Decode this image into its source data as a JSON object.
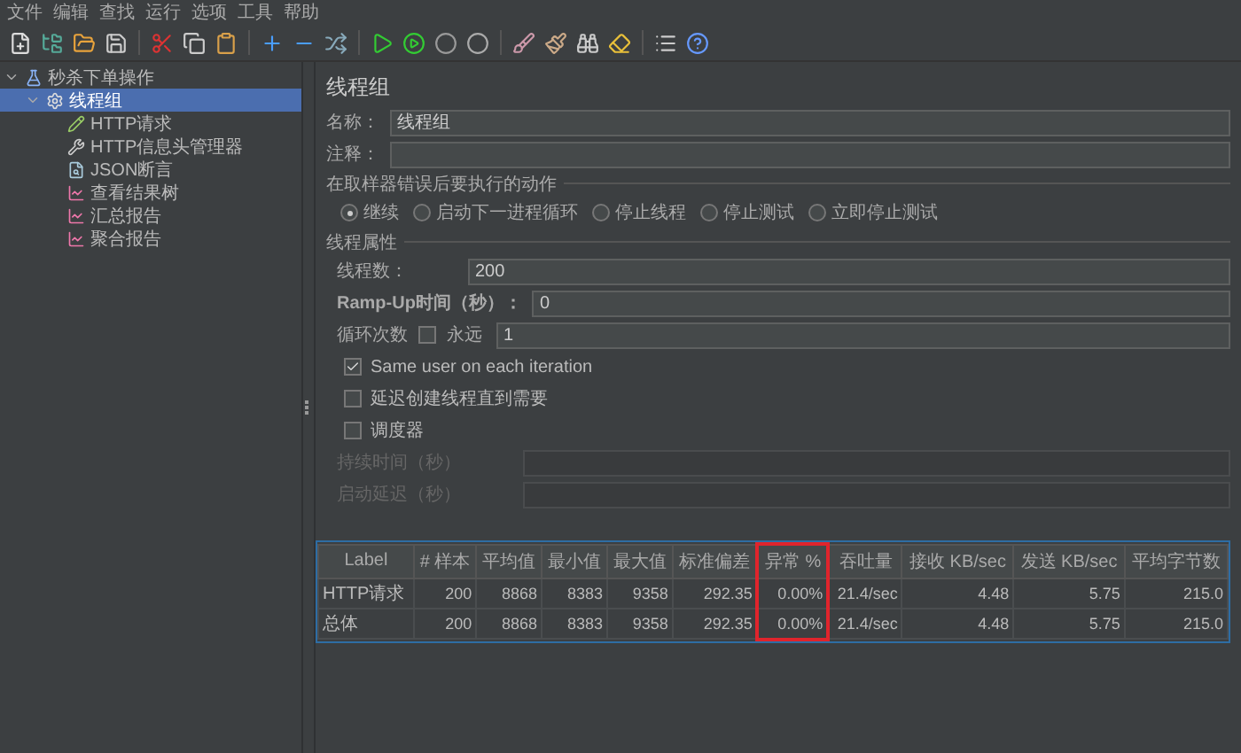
{
  "menu": [
    "文件",
    "编辑",
    "查找",
    "运行",
    "选项",
    "工具",
    "帮助"
  ],
  "tree": [
    {
      "label": "秒杀下单操作",
      "kind": "plan",
      "expanded": true,
      "selected": false,
      "children": [
        {
          "label": "线程组",
          "kind": "threads",
          "expanded": true,
          "selected": true,
          "children": [
            {
              "label": "HTTP请求",
              "kind": "sampler",
              "selected": false
            },
            {
              "label": "HTTP信息头管理器",
              "kind": "config",
              "selected": false
            },
            {
              "label": "JSON断言",
              "kind": "assertion",
              "selected": false
            },
            {
              "label": "查看结果树",
              "kind": "listener",
              "selected": false
            },
            {
              "label": "汇总报告",
              "kind": "listener",
              "selected": false
            },
            {
              "label": "聚合报告",
              "kind": "listener",
              "selected": false
            }
          ]
        }
      ]
    }
  ],
  "panel": {
    "title": "线程组",
    "name_field": {
      "label": "名称：",
      "value": "线程组"
    },
    "comment_field": {
      "label": "注释："
    },
    "error_action": {
      "title": "在取样器错误后要执行的动作",
      "options": [
        {
          "label": "继续",
          "selected": true
        },
        {
          "label": "启动下一进程循环",
          "selected": false
        },
        {
          "label": "停止线程",
          "selected": false
        },
        {
          "label": "停止测试",
          "selected": false
        },
        {
          "label": "立即停止测试",
          "selected": false
        }
      ]
    },
    "thread_props": {
      "title": "线程属性",
      "thread_count": {
        "label": "线程数：",
        "value": "200"
      },
      "ramp_up": {
        "label": "Ramp-Up时间（秒）：",
        "value": "0"
      },
      "loop": {
        "label": "循环次数",
        "forever_label": "永远",
        "forever_checked": false,
        "value": "1"
      },
      "checkboxes": [
        {
          "label": "Same user on each iteration",
          "checked": true
        },
        {
          "label": "延迟创建线程直到需要",
          "checked": false
        },
        {
          "label": "调度器",
          "checked": false
        }
      ],
      "duration": {
        "label": "持续时间（秒）",
        "disabled": true
      },
      "startup_delay": {
        "label": "启动延迟（秒）",
        "disabled": true
      }
    }
  },
  "table": {
    "columns": [
      {
        "label": "Label",
        "highlighted": false
      },
      {
        "label": "# 样本",
        "highlighted": false
      },
      {
        "label": "平均值",
        "highlighted": false
      },
      {
        "label": "最小值",
        "highlighted": false
      },
      {
        "label": "最大值",
        "highlighted": false
      },
      {
        "label": "标准偏差",
        "highlighted": false
      },
      {
        "label": "异常 %",
        "highlighted": true
      },
      {
        "label": "吞吐量",
        "highlighted": false
      },
      {
        "label": "接收 KB/sec",
        "highlighted": false
      },
      {
        "label": "发送 KB/sec",
        "highlighted": false
      },
      {
        "label": "平均字节数",
        "highlighted": false
      }
    ],
    "rows": [
      [
        "HTTP请求",
        "200",
        "8868",
        "8383",
        "9358",
        "292.35",
        "0.00%",
        "21.4/sec",
        "4.48",
        "5.75",
        "215.0"
      ],
      [
        "总体",
        "200",
        "8868",
        "8383",
        "9358",
        "292.35",
        "0.00%",
        "21.4/sec",
        "4.48",
        "5.75",
        "215.0"
      ]
    ]
  }
}
